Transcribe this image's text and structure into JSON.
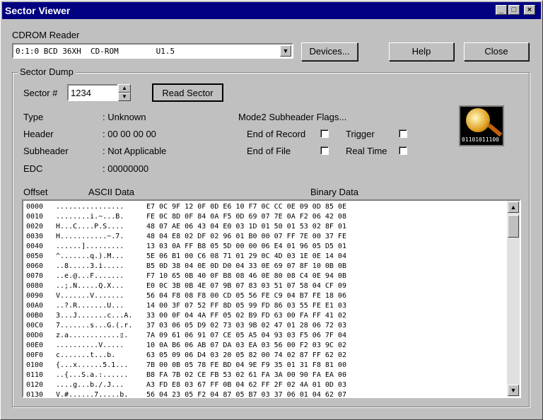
{
  "window": {
    "title": "Sector Viewer"
  },
  "reader": {
    "group_label": "CDROM Reader",
    "selected": "0:1:0 BCD 36XH  CD-ROM        U1.5",
    "devices_label": "Devices...",
    "help_label": "Help",
    "close_label": "Close"
  },
  "dump": {
    "group_label": "Sector Dump",
    "sector_label": "Sector #",
    "sector_value": "1234",
    "read_label": "Read Sector",
    "type_label": "Type",
    "type_value": ": Unknown",
    "header_label": "Header",
    "header_value": ": 00 00 00 00",
    "subheader_label": "Subheader",
    "subheader_value": ": Not Applicable",
    "edc_label": "EDC",
    "edc_value": ": 00000000",
    "flags_title": "Mode2 Subheader Flags...",
    "flag_eor": "End of Record",
    "flag_trigger": "Trigger",
    "flag_eof": "End of File",
    "flag_realtime": "Real Time",
    "icon_text": "01101011100",
    "offset_header": "Offset",
    "ascii_header": "ASCII Data",
    "binary_header": "Binary Data"
  },
  "hex_rows": [
    {
      "offset": "0000",
      "ascii": "................",
      "bin": "E7 0C 9F 12 0F 0D E6 10 F7 0C CC 0E 09 0D 85 0E"
    },
    {
      "offset": "0010",
      "ascii": "........i.~...B.",
      "bin": "FE 0C 8D 0F 84 0A F5 0D 69 07 7E 0A F2 06 42 08"
    },
    {
      "offset": "0020",
      "ascii": "H...C....P.S....",
      "bin": "48 07 AE 06 43 04 E0 03 1D 01 50 01 53 02 8F 01"
    },
    {
      "offset": "0030",
      "ascii": "H...........~.7.",
      "bin": "48 04 E8 02 DF 02 96 01 B0 00 07 FF 7E 00 37 FE"
    },
    {
      "offset": "0040",
      "ascii": "......].........",
      "bin": "13 03 0A FF B8 05 5D 00 00 06 E4 01 96 05 D5 01"
    },
    {
      "offset": "0050",
      "ascii": "^.......q.).M...",
      "bin": "5E 06 B1 00 C6 08 71 01 29 0C 4D 03 1E 0E 14 04"
    },
    {
      "offset": "0060",
      "ascii": "..8.....3.i.....",
      "bin": "B5 0D 38 04 0E 0D D0 04 33 0E 69 07 8F 10 0B 0B"
    },
    {
      "offset": "0070",
      "ascii": "..e.@...F.......",
      "bin": "F7 10 65 0B 40 0F B8 08 46 0E 80 08 C4 0E 94 0B"
    },
    {
      "offset": "0080",
      "ascii": "..;.N.....Q.X...",
      "bin": "E0 0C 3B 0B 4E 07 9B 07 83 03 51 07 58 04 CF 09"
    },
    {
      "offset": "0090",
      "ascii": "V.......V.......",
      "bin": "56 04 F8 08 F8 00 CD 05 56 FE C9 04 B7 FE 18 06"
    },
    {
      "offset": "00A0",
      "ascii": "..?.R.......U...",
      "bin": "14 00 3F 07 52 FF 8D 05 99 FD 86 03 55 FE E1 03"
    },
    {
      "offset": "00B0",
      "ascii": "3...J.......c...A.",
      "bin": "33 00 0F 04 4A FF 05 02 B9 FD 63 00 FA FF 41 02"
    },
    {
      "offset": "00C0",
      "ascii": "7.......s...G.(.r.",
      "bin": "37 03 06 05 D9 02 73 03 9B 02 47 01 28 06 72 03"
    },
    {
      "offset": "00D0",
      "ascii": "z.a............▯.",
      "bin": "7A 09 61 06 91 07 CE 05 A5 04 93 03 F5 06 7F 04"
    },
    {
      "offset": "00E0",
      "ascii": "..........V.....",
      "bin": "10 0A B6 06 AB 07 DA 03 EA 03 56 00 F2 03 9C 02"
    },
    {
      "offset": "00F0",
      "ascii": "c.......t...b.",
      "bin": "63 05 09 06 D4 03 20 05 82 00 74 02 87 FF 62 02"
    },
    {
      "offset": "0100",
      "ascii": "{...x......5.1...",
      "bin": "7B 00 0B 05 78 FE BD 04 9E F9 35 01 31 F8 81 00"
    },
    {
      "offset": "0110",
      "ascii": "..{...S.a.:......",
      "bin": "B8 FA 7B 02 CE FB 53 02 61 FA 3A 00 90 FA EA 00"
    },
    {
      "offset": "0120",
      "ascii": "....g...b./.J...",
      "bin": "A3 FD E8 03 67 FF 0B 04 62 FF 2F 02 4A 01 0D 03"
    },
    {
      "offset": "0130",
      "ascii": "V.#......7.....b.",
      "bin": "56 04 23 05 F2 04 87 05 B7 03 37 06 01 04 62 07"
    }
  ]
}
